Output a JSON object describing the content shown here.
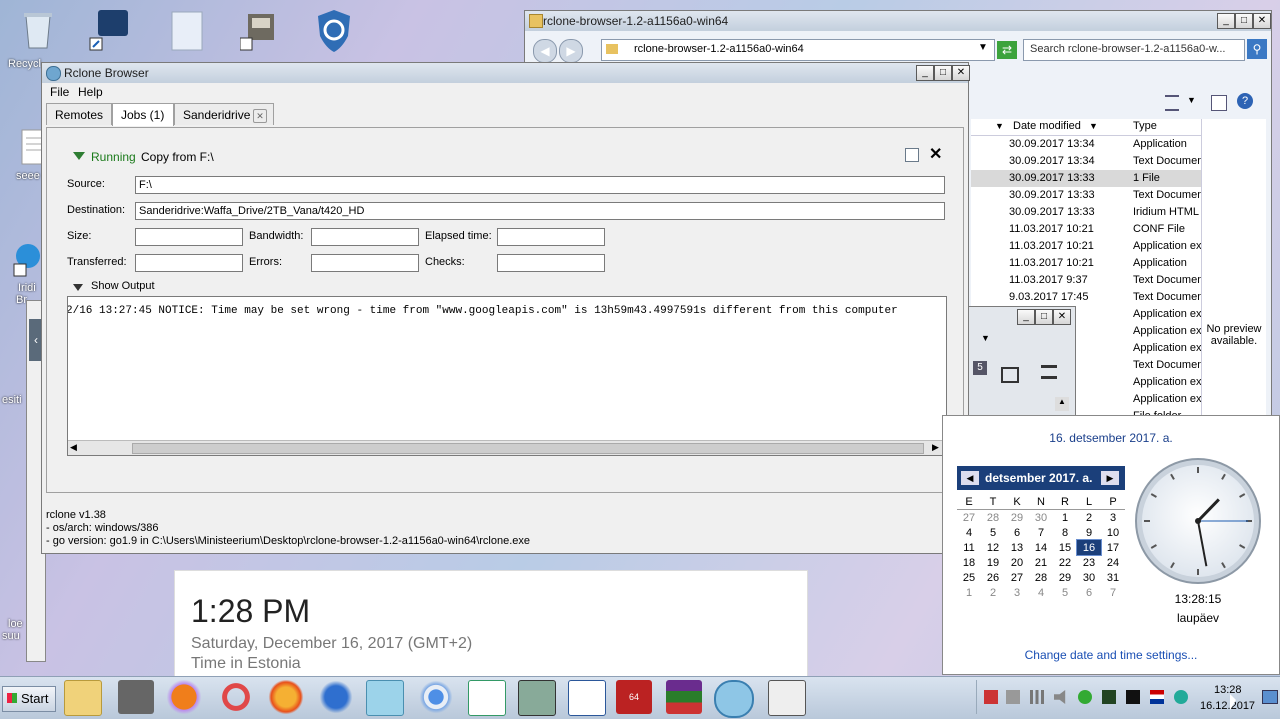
{
  "desktop": {
    "labels": [
      "Recycl",
      "seee",
      "Iridi",
      "Br",
      "esiti",
      "loe",
      "suu"
    ]
  },
  "explorer": {
    "title": "rclone-browser-1.2-a1156a0-win64",
    "address": "rclone-browser-1.2-a1156a0-win64",
    "search_placeholder": "Search rclone-browser-1.2-a1156a0-w...",
    "col_date": "Date modified",
    "col_type": "Type",
    "no_preview": "No preview available.",
    "rows": [
      {
        "date": "30.09.2017 13:34",
        "type": "Application"
      },
      {
        "date": "30.09.2017 13:34",
        "type": "Text Documen"
      },
      {
        "date": "30.09.2017 13:33",
        "type": "1 File"
      },
      {
        "date": "30.09.2017 13:33",
        "type": "Text Documen"
      },
      {
        "date": "30.09.2017 13:33",
        "type": "Iridium HTML I"
      },
      {
        "date": "11.03.2017 10:21",
        "type": "CONF File"
      },
      {
        "date": "11.03.2017 10:21",
        "type": "Application ex"
      },
      {
        "date": "11.03.2017 10:21",
        "type": "Application"
      },
      {
        "date": "11.03.2017 9:37",
        "type": "Text Documen"
      },
      {
        "date": "9.03.2017 17:45",
        "type": "Text Documen"
      },
      {
        "date": ":43",
        "type": "Application ex"
      },
      {
        "date": ":19",
        "type": "Application ex"
      },
      {
        "date": ":15",
        "type": "Application ex"
      },
      {
        "date": "7:05",
        "type": "Text Documen"
      },
      {
        "date": ":58",
        "type": "Application ex"
      },
      {
        "date": ":58",
        "type": "Application ex"
      },
      {
        "date": "8:21",
        "type": "File folder"
      }
    ]
  },
  "rclone": {
    "title": "Rclone Browser",
    "menu": [
      "File",
      "Help"
    ],
    "tabs": [
      "Remotes",
      "Jobs (1)",
      "Sanderidrive"
    ],
    "job": {
      "status": "Running",
      "description": "Copy from F:\\",
      "source_label": "Source:",
      "source": "F:\\",
      "destination_label": "Destination:",
      "destination": "Sanderidrive:Waffa_Drive/2TB_Vana/t420_HD",
      "size_label": "Size:",
      "bandwidth_label": "Bandwidth:",
      "elapsed_label": "Elapsed time:",
      "transferred_label": "Transferred:",
      "errors_label": "Errors:",
      "checks_label": "Checks:",
      "show_output": "Show Output",
      "output": "2/16 13:27:45 NOTICE: Time may be set wrong - time from \"www.googleapis.com\" is 13h59m43.4997591s different from this computer"
    },
    "status_lines": [
      "rclone v1.38",
      "- os/arch: windows/386",
      "- go version: go1.9 in C:\\Users\\Ministeerium\\Desktop\\rclone-browser-1.2-a1156a0-win64\\rclone.exe"
    ]
  },
  "google_card": {
    "time": "1:28 PM",
    "date": "Saturday, December 16, 2017 (GMT+2)",
    "place": "Time in Estonia"
  },
  "clock_popup": {
    "header": "16. detsember 2017. a.",
    "month": "detsember 2017. a.",
    "weekdays": [
      "E",
      "T",
      "K",
      "N",
      "R",
      "L",
      "P"
    ],
    "weeks": [
      [
        "27",
        "28",
        "29",
        "30",
        "1",
        "2",
        "3"
      ],
      [
        "4",
        "5",
        "6",
        "7",
        "8",
        "9",
        "10"
      ],
      [
        "11",
        "12",
        "13",
        "14",
        "15",
        "16",
        "17"
      ],
      [
        "18",
        "19",
        "20",
        "21",
        "22",
        "23",
        "24"
      ],
      [
        "25",
        "26",
        "27",
        "28",
        "29",
        "30",
        "31"
      ],
      [
        "1",
        "2",
        "3",
        "4",
        "5",
        "6",
        "7"
      ]
    ],
    "selected_day": "16",
    "digital_time": "13:28:15",
    "weekday": "laupäev",
    "change_link": "Change date and time settings...",
    "clock": {
      "hours": 13,
      "minutes": 28,
      "seconds": 15
    }
  },
  "small_window": {
    "badge": "5"
  },
  "taskbar": {
    "start": "Start",
    "time": "13:28",
    "date": "16.12.2017",
    "badge_64": "64"
  }
}
